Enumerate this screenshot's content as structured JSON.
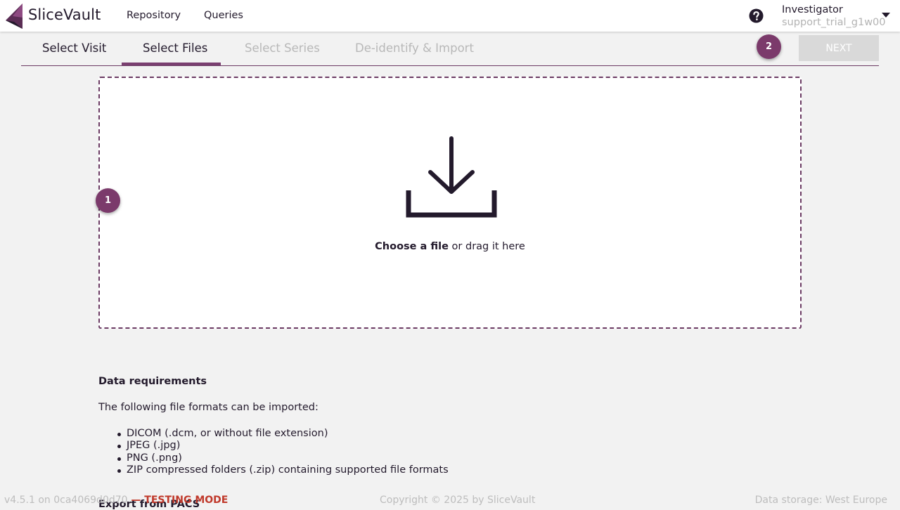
{
  "app": {
    "brand": "SliceVault",
    "logo_icon": "slicevault-logo-icon",
    "accent_color": "#7b3a6b"
  },
  "nav": {
    "links": [
      "Repository",
      "Queries"
    ],
    "help_icon": "question-circle-icon",
    "user_role": "Investigator",
    "user_name": "support_trial_g1w00",
    "menu_icon": "caret-down-icon"
  },
  "stepper": {
    "steps": [
      {
        "label": "Select Visit",
        "state": "done"
      },
      {
        "label": "Select Files",
        "state": "active"
      },
      {
        "label": "Select Series",
        "state": "disabled"
      },
      {
        "label": "De-identify & Import",
        "state": "disabled"
      }
    ],
    "next_label": "NEXT",
    "next_enabled": false
  },
  "hints": {
    "badge_1": "1",
    "badge_2": "2"
  },
  "dropzone": {
    "icon": "download-icon",
    "choose_label": "Choose a file",
    "drag_label": " or drag it here"
  },
  "requirements": {
    "title": "Data requirements",
    "intro": "The following file formats can be imported:",
    "formats": [
      "DICOM (.dcm, or without file extension)",
      "JPEG (.jpg)",
      "PNG (.png)",
      "ZIP compressed folders (.zip) containing supported file formats"
    ],
    "export_title": "Export from PACS"
  },
  "footer": {
    "version": "v4.5.1 on 0ca4069d0d70",
    "testing_mode": " — TESTING MODE",
    "copyright": "Copyright © 2025 by SliceVault",
    "storage": "Data storage: West Europe"
  }
}
